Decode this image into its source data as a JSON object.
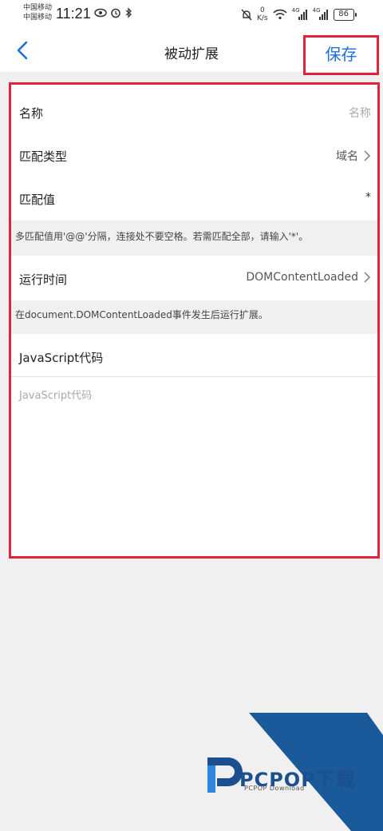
{
  "status_bar": {
    "carrier_1": "中国移动",
    "carrier_2": "中国移动",
    "time": "11:21",
    "net_speed_value": "0",
    "net_speed_unit": "K/s",
    "signal_1": "4G",
    "signal_2": "4G",
    "battery": "86"
  },
  "nav": {
    "title": "被动扩展",
    "save_label": "保存",
    "back_icon": "chevron-left-icon"
  },
  "form": {
    "name_label": "名称",
    "name_placeholder": "名称",
    "match_type_label": "匹配类型",
    "match_type_value": "域名",
    "match_value_label": "匹配值",
    "match_value_value": "*",
    "match_hint": "多匹配值用'@@'分隔，连接处不要空格。若需匹配全部，请输入'*'。",
    "run_time_label": "运行时间",
    "run_time_value": "DOMContentLoaded",
    "run_time_hint": "在document.DOMContentLoaded事件发生后运行扩展。",
    "code_label": "JavaScript代码",
    "code_placeholder": "JavaScript代码"
  },
  "watermark": {
    "brand": "PCPOP下载",
    "sub": "PCPOP Download"
  },
  "colors": {
    "accent_blue": "#1c6fd8",
    "highlight_red": "#e0243b",
    "background": "#f0f0f0"
  }
}
